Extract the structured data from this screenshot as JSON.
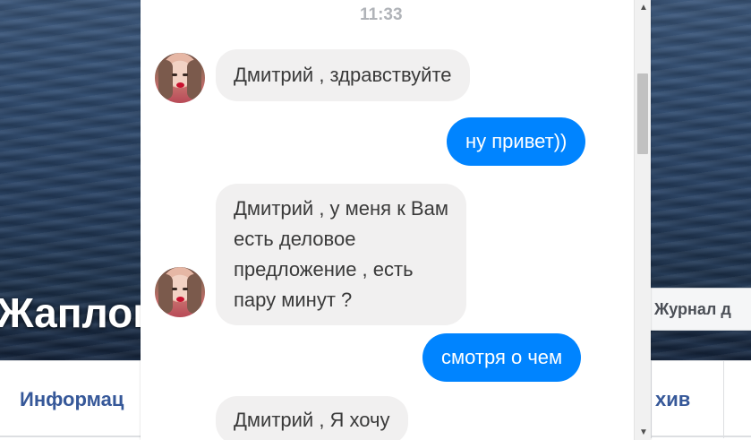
{
  "profile": {
    "name": "Жаплов",
    "journal_button": "Журнал д",
    "nav": {
      "tab_info": "Информац",
      "tab_archive": "хив"
    }
  },
  "chat": {
    "timestamp": "11:33",
    "messages": [
      {
        "direction": "in",
        "lines": [
          "Дмитрий , здравствуйте"
        ]
      },
      {
        "direction": "out",
        "lines": [
          "ну привет))"
        ]
      },
      {
        "direction": "in",
        "lines": [
          "Дмитрий , у меня к Вам",
          "есть деловое",
          "предложение , есть",
          "пару минут ?"
        ]
      },
      {
        "direction": "out",
        "lines": [
          "смотря о чем"
        ]
      },
      {
        "direction": "in",
        "lines": [
          "Дмитрий , Я хочу"
        ]
      }
    ]
  },
  "scrollbar": {
    "up_arrow": "▲",
    "down_arrow": "▼"
  },
  "colors": {
    "outgoing": "#0084ff",
    "incoming": "#f1f0f0",
    "link": "#365899"
  }
}
